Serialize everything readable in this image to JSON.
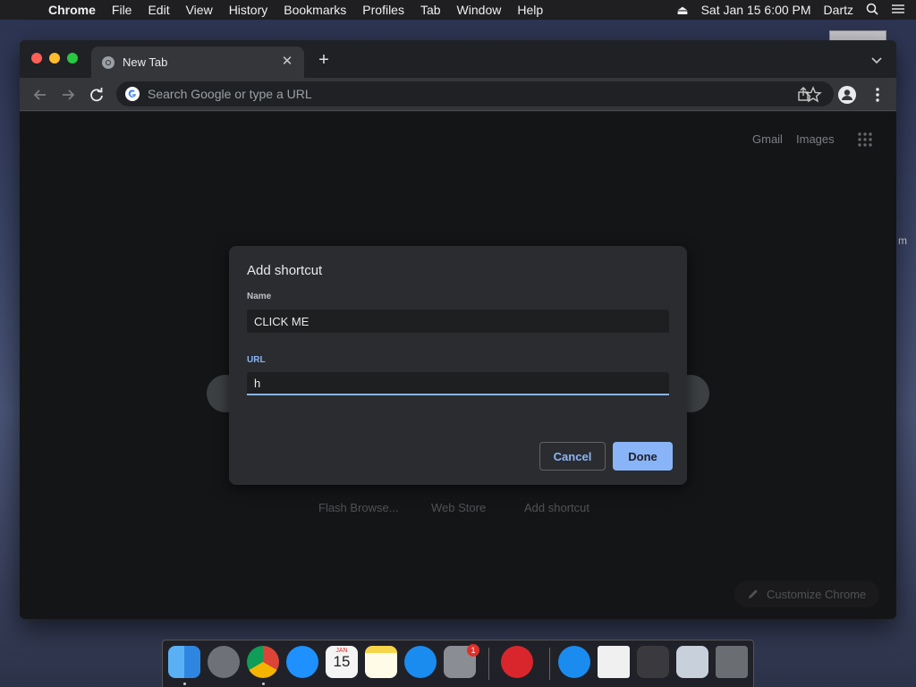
{
  "menubar": {
    "app_name": "Chrome",
    "items": [
      "File",
      "Edit",
      "View",
      "History",
      "Bookmarks",
      "Profiles",
      "Tab",
      "Window",
      "Help"
    ],
    "datetime": "Sat Jan 15  6:00 PM",
    "user": "Dartz"
  },
  "desktop": {
    "edge_text": "m"
  },
  "browser": {
    "tab_title": "New Tab",
    "omnibox_placeholder": "Search Google or type a URL"
  },
  "page": {
    "links": {
      "gmail": "Gmail",
      "images": "Images"
    },
    "shortcuts": [
      "Flash Browse...",
      "Web Store",
      "Add shortcut"
    ],
    "customize_label": "Customize Chrome"
  },
  "dialog": {
    "title": "Add shortcut",
    "name_label": "Name",
    "name_value": "CLICK ME",
    "url_label": "URL",
    "url_value": "h",
    "cancel_label": "Cancel",
    "done_label": "Done"
  },
  "dock": {
    "calendar_month": "JAN",
    "calendar_day": "15",
    "settings_badge": "1"
  },
  "colors": {
    "accent": "#8ab4f8",
    "window_bg": "#202124",
    "toolbar_bg": "#35363a",
    "dialog_bg": "#2b2c2f"
  }
}
